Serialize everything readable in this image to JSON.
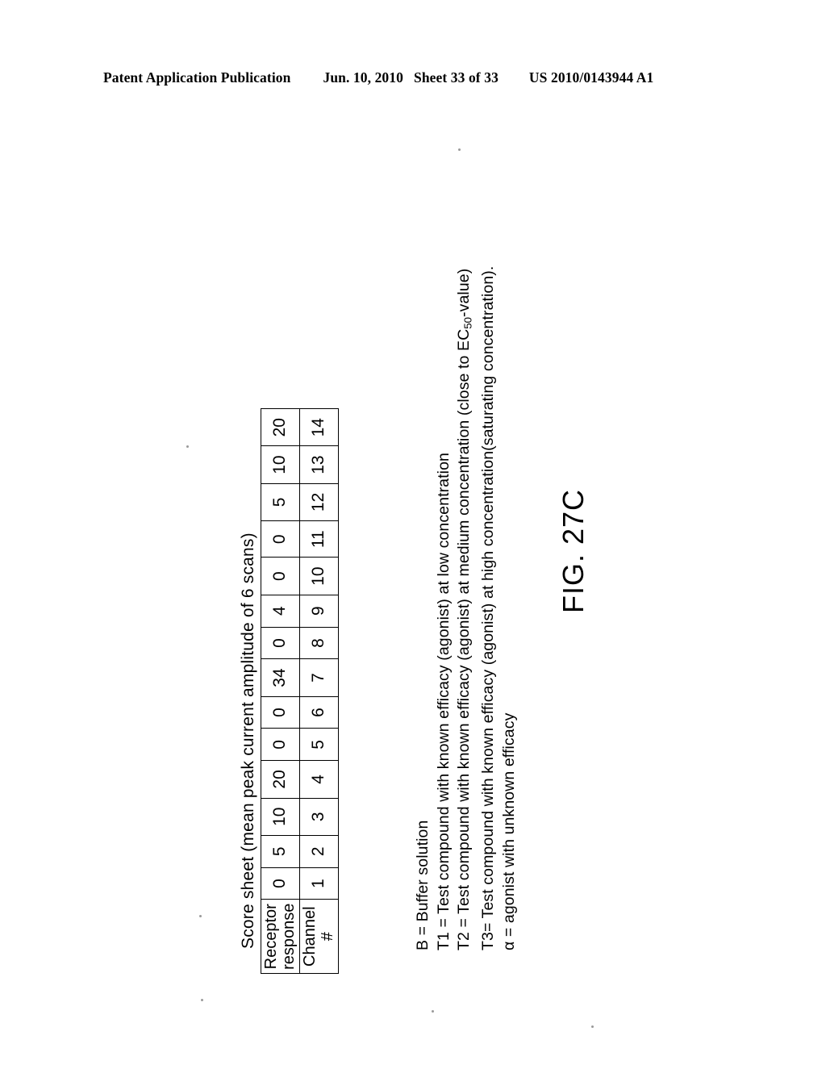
{
  "header": {
    "publication": "Patent Application Publication",
    "date": "Jun. 10, 2010",
    "sheet": "Sheet 33 of 33",
    "patent_number": "US 2010/0143944 A1"
  },
  "figure": {
    "label": "FIG. 27C",
    "title": "Score sheet (mean peak current amplitude of 6 scans)"
  },
  "table": {
    "row_headers": [
      "Receptor",
      "response",
      "Channel #"
    ],
    "receptor_response_label_line1": "Receptor",
    "receptor_response_label_line2": "response",
    "channel_label": "Channel #",
    "receptor_response": [
      "0",
      "5",
      "10",
      "20",
      "0",
      "0",
      "34",
      "0",
      "4",
      "0",
      "0",
      "5",
      "10",
      "20"
    ],
    "channel": [
      "1",
      "2",
      "3",
      "4",
      "5",
      "6",
      "7",
      "8",
      "9",
      "10",
      "11",
      "12",
      "13",
      "14"
    ]
  },
  "legend": {
    "line_b": "B = Buffer solution",
    "line_t1": "T1 = Test compound with known efficacy (agonist) at low concentration",
    "line_t2_pre": "T2 = Test compound with known efficacy (agonist) at medium concentration (close to EC",
    "line_t2_sub": "50",
    "line_t2_post": "-value)",
    "line_t3": "T3= Test compound with known efficacy (agonist) at high concentration(saturating concentration).",
    "line_alpha": "α = agonist with unknown efficacy"
  },
  "chart_data": {
    "type": "table",
    "title": "Score sheet (mean peak current amplitude of 6 scans)",
    "categories": [
      "1",
      "2",
      "3",
      "4",
      "5",
      "6",
      "7",
      "8",
      "9",
      "10",
      "11",
      "12",
      "13",
      "14"
    ],
    "xlabel": "Channel #",
    "ylabel": "Receptor response",
    "series": [
      {
        "name": "Receptor response",
        "values": [
          0,
          5,
          10,
          20,
          0,
          0,
          34,
          0,
          4,
          0,
          0,
          5,
          10,
          20
        ]
      }
    ],
    "orientation": "rotated-90-ccw",
    "grid": true
  }
}
